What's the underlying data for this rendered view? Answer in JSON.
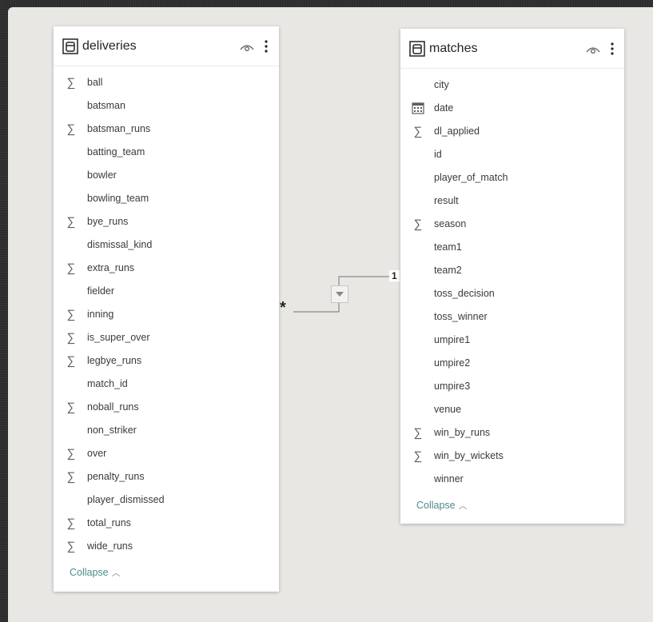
{
  "tables": {
    "deliveries": {
      "title": "deliveries",
      "fields": [
        {
          "name": "ball",
          "icon": "sigma-icon"
        },
        {
          "name": "batsman",
          "icon": ""
        },
        {
          "name": "batsman_runs",
          "icon": "sigma-icon"
        },
        {
          "name": "batting_team",
          "icon": ""
        },
        {
          "name": "bowler",
          "icon": ""
        },
        {
          "name": "bowling_team",
          "icon": ""
        },
        {
          "name": "bye_runs",
          "icon": "sigma-icon"
        },
        {
          "name": "dismissal_kind",
          "icon": ""
        },
        {
          "name": "extra_runs",
          "icon": "sigma-icon"
        },
        {
          "name": "fielder",
          "icon": ""
        },
        {
          "name": "inning",
          "icon": "sigma-icon"
        },
        {
          "name": "is_super_over",
          "icon": "sigma-icon"
        },
        {
          "name": "legbye_runs",
          "icon": "sigma-icon"
        },
        {
          "name": "match_id",
          "icon": ""
        },
        {
          "name": "noball_runs",
          "icon": "sigma-icon"
        },
        {
          "name": "non_striker",
          "icon": ""
        },
        {
          "name": "over",
          "icon": "sigma-icon"
        },
        {
          "name": "penalty_runs",
          "icon": "sigma-icon"
        },
        {
          "name": "player_dismissed",
          "icon": ""
        },
        {
          "name": "total_runs",
          "icon": "sigma-icon"
        },
        {
          "name": "wide_runs",
          "icon": "sigma-icon"
        }
      ],
      "collapse_label": "Collapse",
      "collapse_icon": "chevron-up-icon"
    },
    "matches": {
      "title": "matches",
      "fields": [
        {
          "name": "city",
          "icon": ""
        },
        {
          "name": "date",
          "icon": "calendar-icon"
        },
        {
          "name": "dl_applied",
          "icon": "sigma-icon"
        },
        {
          "name": "id",
          "icon": ""
        },
        {
          "name": "player_of_match",
          "icon": ""
        },
        {
          "name": "result",
          "icon": ""
        },
        {
          "name": "season",
          "icon": "sigma-icon"
        },
        {
          "name": "team1",
          "icon": ""
        },
        {
          "name": "team2",
          "icon": ""
        },
        {
          "name": "toss_decision",
          "icon": ""
        },
        {
          "name": "toss_winner",
          "icon": ""
        },
        {
          "name": "umpire1",
          "icon": ""
        },
        {
          "name": "umpire2",
          "icon": ""
        },
        {
          "name": "umpire3",
          "icon": ""
        },
        {
          "name": "venue",
          "icon": ""
        },
        {
          "name": "win_by_runs",
          "icon": "sigma-icon"
        },
        {
          "name": "win_by_wickets",
          "icon": "sigma-icon"
        },
        {
          "name": "winner",
          "icon": ""
        }
      ],
      "collapse_label": "Collapse",
      "collapse_icon": "chevron-up-icon"
    }
  },
  "relationship": {
    "many_side": "*",
    "one_side": "1",
    "filter_icon": "single-direction-filter-icon"
  },
  "colors": {
    "canvas": "#e9e7e4",
    "link": "#4f8a8b",
    "connector": "#8a8886"
  }
}
